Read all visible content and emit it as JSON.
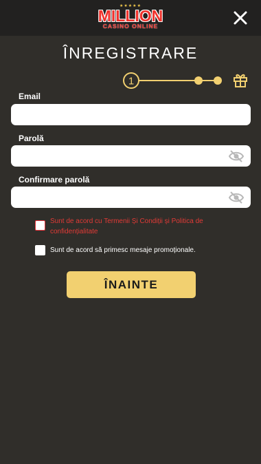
{
  "header": {
    "logo_stars": "★★★★★",
    "logo_brand": "MILLION",
    "logo_sub": "CASINO ONLINE"
  },
  "page": {
    "title": "ÎNREGISTRARE"
  },
  "stepper": {
    "current_step": "1",
    "total_steps": 4,
    "final_step_icon": "gift-icon"
  },
  "form": {
    "email_label": "Email",
    "email_value": "",
    "password_label": "Parolă",
    "password_value": "",
    "confirm_label": "Confirmare parolă",
    "confirm_value": "",
    "visibility_icon": "eye-off-icon"
  },
  "terms": {
    "prefix": "Sunt de acord cu ",
    "terms_link": "Termenii Și Condiții",
    "and": " și ",
    "privacy_link": "Politica de confidențialitate",
    "checked": false
  },
  "promo": {
    "label": "Sunt de acord să primesc mesaje promoționale.",
    "checked": false
  },
  "actions": {
    "next_label": "ÎNAINTE"
  },
  "colors": {
    "background": "#302e2a",
    "topbar": "#222120",
    "accent_gold": "#f2d070",
    "error_red": "#e23a36",
    "logo_red": "#f0332d"
  }
}
